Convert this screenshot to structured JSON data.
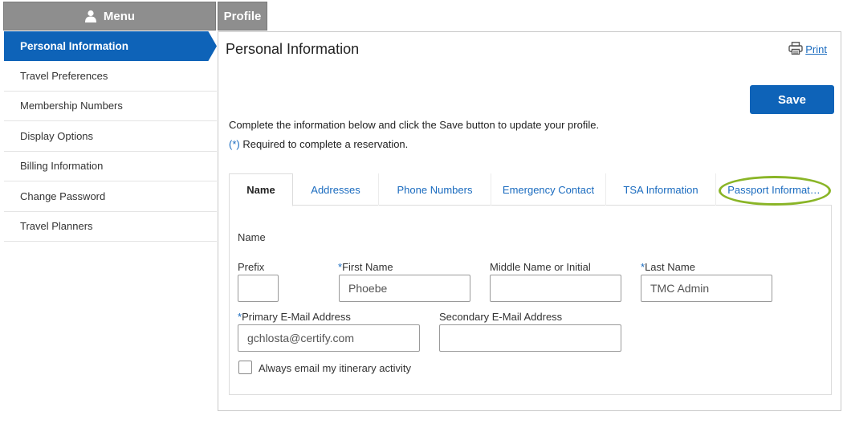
{
  "header": {
    "menu_label": "Menu",
    "profile_label": "Profile"
  },
  "sidebar": {
    "items": [
      {
        "label": "Personal Information",
        "active": true
      },
      {
        "label": "Travel Preferences"
      },
      {
        "label": "Membership Numbers"
      },
      {
        "label": "Display Options"
      },
      {
        "label": "Billing Information"
      },
      {
        "label": "Change Password"
      },
      {
        "label": "Travel Planners"
      }
    ]
  },
  "main": {
    "title": "Personal Information",
    "print_label": "Print",
    "save_label": "Save",
    "instructions": "Complete the information below and click the Save button to update your profile.",
    "required_star": "(*)",
    "required_note": " Required to complete a reservation.",
    "tabs": [
      {
        "label": "Name",
        "active": true
      },
      {
        "label": "Addresses"
      },
      {
        "label": "Phone Numbers"
      },
      {
        "label": "Emergency Contact"
      },
      {
        "label": "TSA Information"
      },
      {
        "label": "Passport Informat…",
        "highlighted": true
      }
    ],
    "form": {
      "section_label": "Name",
      "prefix": {
        "label": "Prefix",
        "value": ""
      },
      "first_name": {
        "required": "*",
        "label": "First Name",
        "value": "Phoebe"
      },
      "middle_name": {
        "label": "Middle Name or Initial",
        "value": ""
      },
      "last_name": {
        "required": "*",
        "label": "Last Name",
        "value": "TMC Admin"
      },
      "primary_email": {
        "required": "*",
        "label": "Primary E-Mail Address",
        "value": "gchlosta@certify.com"
      },
      "secondary_email": {
        "label": "Secondary E-Mail Address",
        "value": ""
      },
      "email_itinerary": {
        "label": "Always email my itinerary activity",
        "checked": false
      }
    }
  },
  "colors": {
    "accent": "#0e63b8",
    "link": "#1a6bbf",
    "highlight": "#8ab527",
    "header_gray": "#8e8e8e"
  },
  "icons": [
    "user-icon",
    "printer-icon"
  ]
}
